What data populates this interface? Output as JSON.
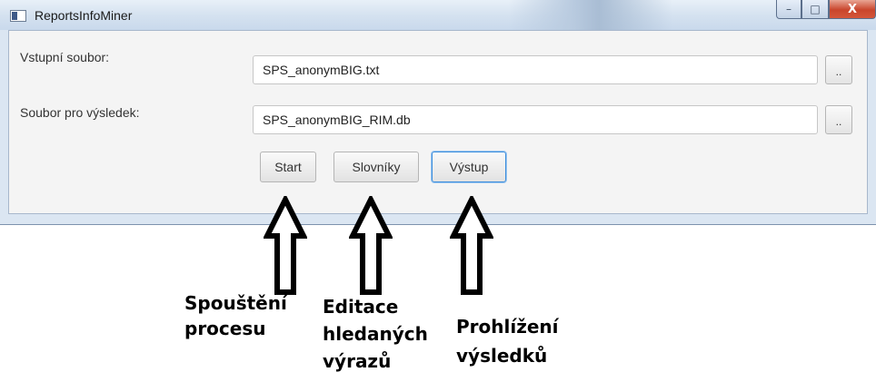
{
  "window": {
    "title": "ReportsInfoMiner",
    "controls": {
      "minimize": "–",
      "maximize": "□",
      "close": "X"
    }
  },
  "form": {
    "input_label": "Vstupní soubor:",
    "input_value": "SPS_anonymBIG.txt",
    "output_label": "Soubor pro výsledek:",
    "output_value": "SPS_anonymBIG_RIM.db",
    "browse_label": ".."
  },
  "buttons": {
    "start": "Start",
    "dictionaries": "Slovníky",
    "output": "Výstup"
  },
  "annotations": {
    "start": [
      "Spouštění",
      "procesu"
    ],
    "dictionaries": [
      "Editace",
      "hledaných",
      "výrazů"
    ],
    "output": [
      "Prohlížení",
      "výsledků"
    ]
  },
  "icons": [
    "app-icon",
    "minimize-icon",
    "maximize-icon",
    "close-icon",
    "up-arrow-icon"
  ]
}
